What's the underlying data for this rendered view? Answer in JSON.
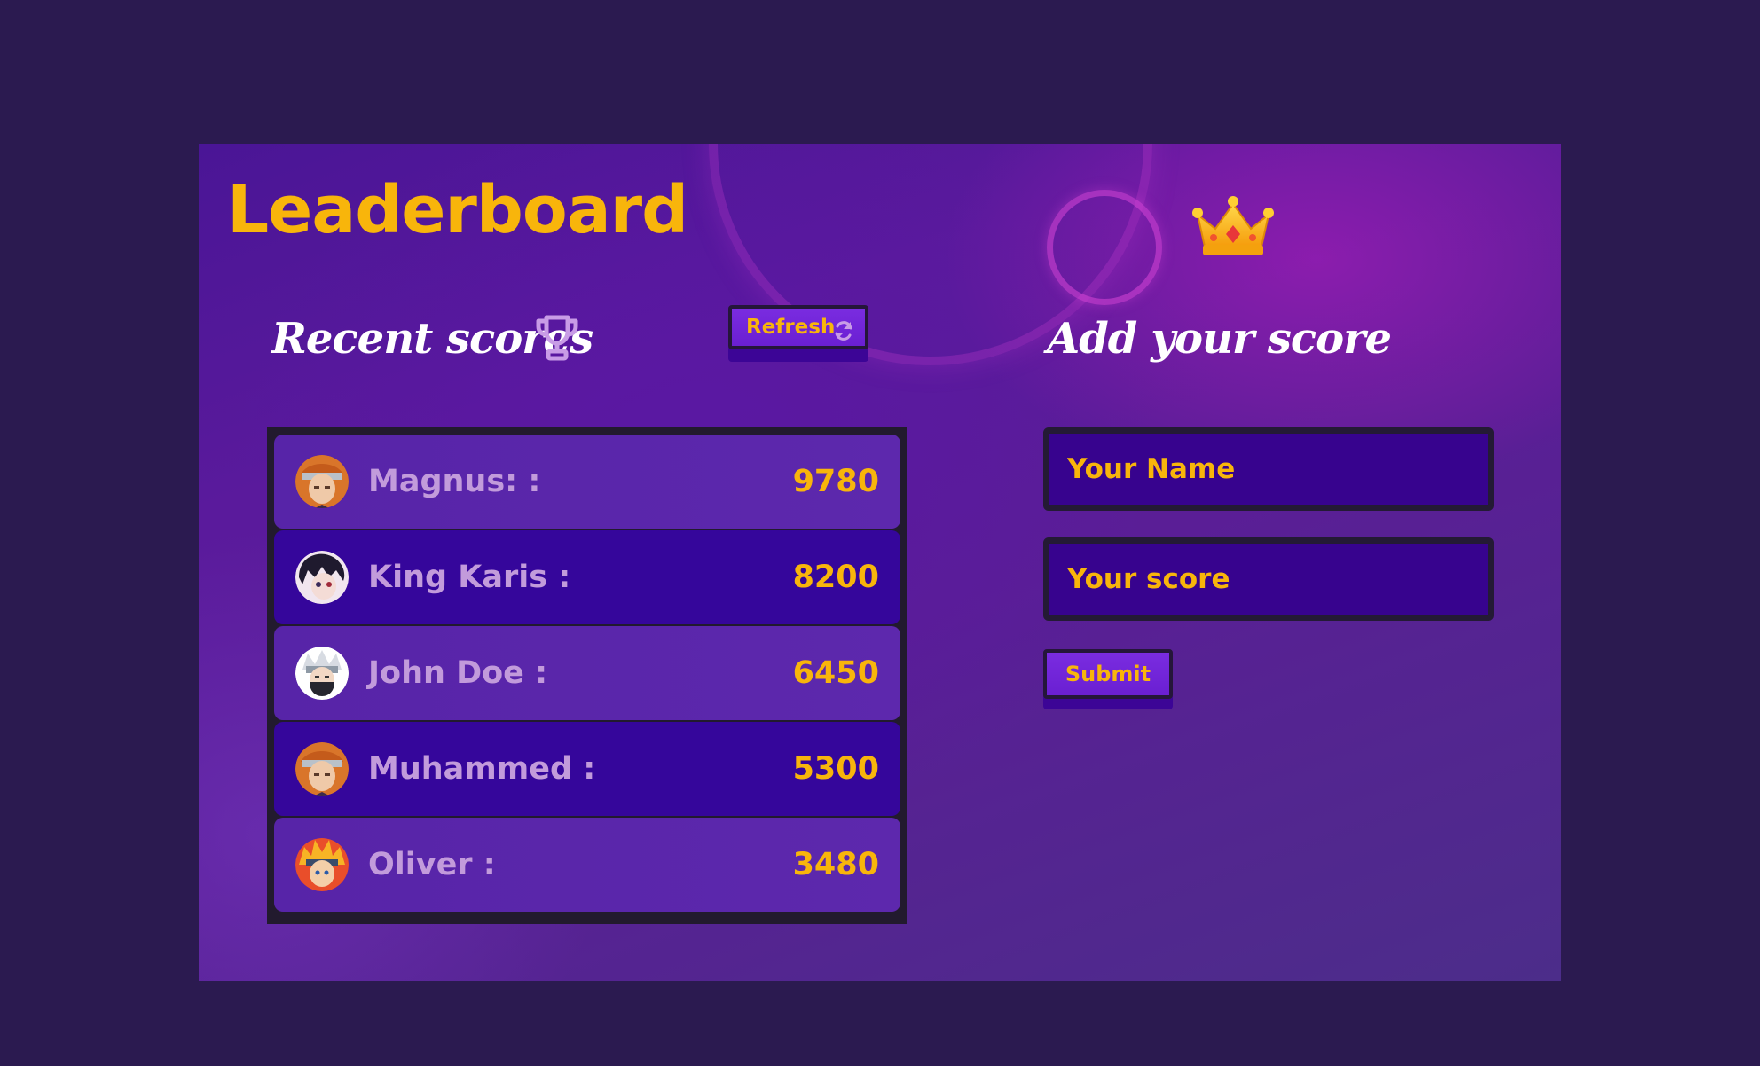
{
  "header": {
    "title": "Leaderboard",
    "crown_icon": "crown-icon"
  },
  "recent": {
    "heading": "Recent scores",
    "trophy_icon": "trophy-icon",
    "refresh_label": "Refresh",
    "refresh_icon": "refresh-icon",
    "scores": [
      {
        "name": "Magnus: :",
        "score": "9780",
        "avatar": "avatar-orange-headband"
      },
      {
        "name": "King Karis :",
        "score": "8200",
        "avatar": "avatar-dark-hair"
      },
      {
        "name": "John Doe :",
        "score": "6450",
        "avatar": "avatar-white-hair-masked"
      },
      {
        "name": "Muhammed :",
        "score": "5300",
        "avatar": "avatar-orange-headband"
      },
      {
        "name": "Oliver :",
        "score": "3480",
        "avatar": "avatar-blond-spiky"
      }
    ]
  },
  "add": {
    "heading": "Add your score",
    "name_placeholder": "Your Name",
    "score_placeholder": "Your score",
    "submit_label": "Submit"
  },
  "colors": {
    "page_background": "#2b1a50",
    "accent_yellow": "#f8b50b",
    "name_text": "#c29bdb",
    "row_dark": "#35069b",
    "input_fill": "#37038e"
  }
}
